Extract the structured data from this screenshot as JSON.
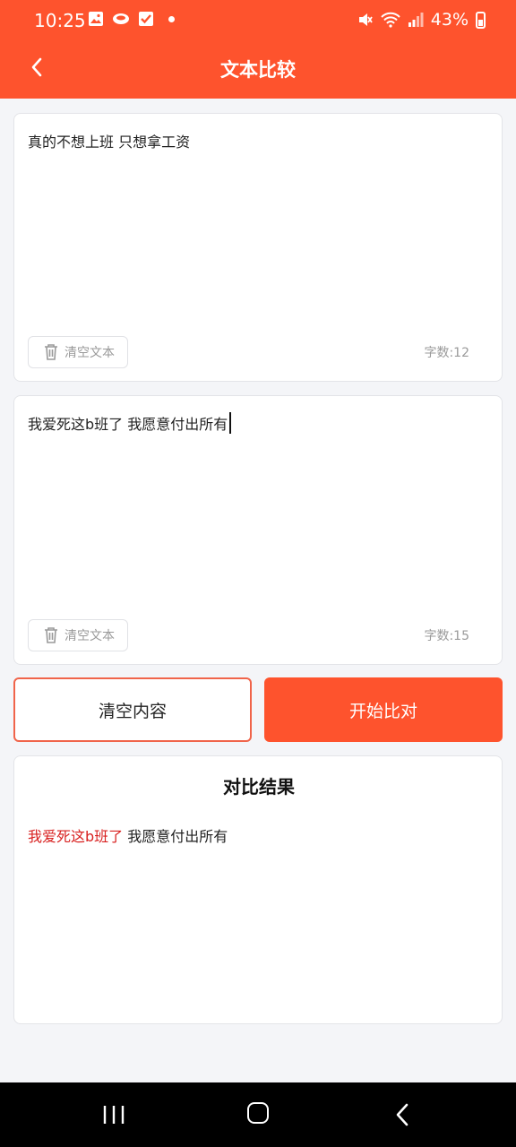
{
  "status_bar": {
    "time": "10:25",
    "battery": "43%"
  },
  "header": {
    "title": "文本比较"
  },
  "input1": {
    "text": "真的不想上班 只想拿工资",
    "clear_label": "清空文本",
    "count_label": "字数:12"
  },
  "input2": {
    "text": "我爱死这b班了 我愿意付出所有",
    "clear_label": "清空文本",
    "count_label": "字数:15"
  },
  "actions": {
    "clear_all_label": "清空内容",
    "start_label": "开始比对"
  },
  "result": {
    "title": "对比结果",
    "diff_text": "我爱死这b班了",
    "same_text": " 我愿意付出所有"
  },
  "colors": {
    "accent": "#fe532d",
    "diff": "#d8201f"
  }
}
